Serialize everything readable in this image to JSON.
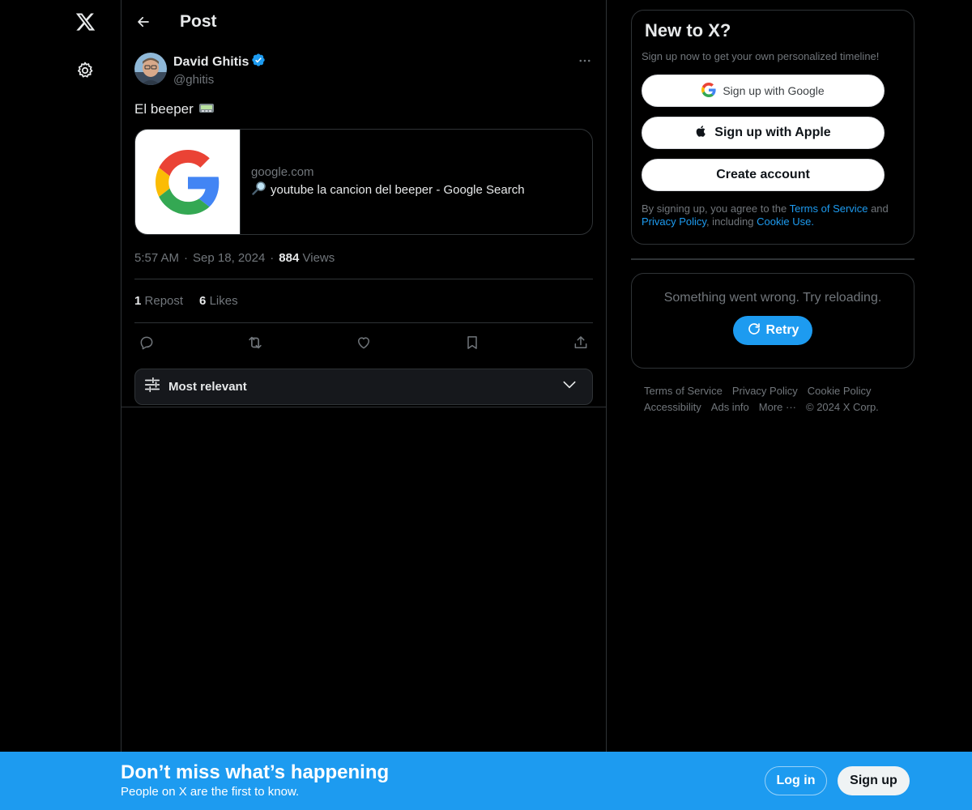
{
  "nav": {
    "logo_icon": "x-logo-icon",
    "settings_icon": "gear-icon"
  },
  "header": {
    "title": "Post",
    "back_icon": "arrow-left-icon"
  },
  "post": {
    "author_name": "David Ghitis",
    "author_handle": "@ghitis",
    "verified": true,
    "text": "El beeper",
    "text_emoji": "pager-emoji",
    "card": {
      "domain": "google.com",
      "title": "youtube la cancion del beeper - Google Search",
      "title_icon": "magnifier-emoji"
    },
    "time": "5:57 AM",
    "date": "Sep 18, 2024",
    "views_count": "884",
    "views_label": "Views",
    "separator": "·",
    "reposts_count": "1",
    "reposts_label": "Repost",
    "likes_count": "6",
    "likes_label": "Likes"
  },
  "replies_sort": {
    "label": "Most relevant"
  },
  "signup_box": {
    "title": "New to X?",
    "subtitle": "Sign up now to get your own personalized timeline!",
    "google_label": "Sign up with Google",
    "apple_label": "Sign up with Apple",
    "create_label": "Create account",
    "legal_prefix": "By signing up, you agree to the",
    "terms": "Terms of Service",
    "and": "and",
    "privacy": "Privacy Policy",
    "including": ", including",
    "cookie": "Cookie Use."
  },
  "error_box": {
    "message": "Something went wrong. Try reloading.",
    "retry_label": "Retry"
  },
  "footer": {
    "terms": "Terms of Service",
    "privacy": "Privacy Policy",
    "cookie": "Cookie Policy",
    "accessibility": "Accessibility",
    "ads": "Ads info",
    "more": "More ···",
    "copyright": "© 2024 X Corp."
  },
  "banner": {
    "title": "Don’t miss what’s happening",
    "subtitle": "People on X are the first to know.",
    "login_label": "Log in",
    "signup_label": "Sign up"
  },
  "colors": {
    "accent": "#1d9bf0",
    "background": "#000000",
    "border": "#2f3336",
    "muted_text": "#71767b"
  }
}
